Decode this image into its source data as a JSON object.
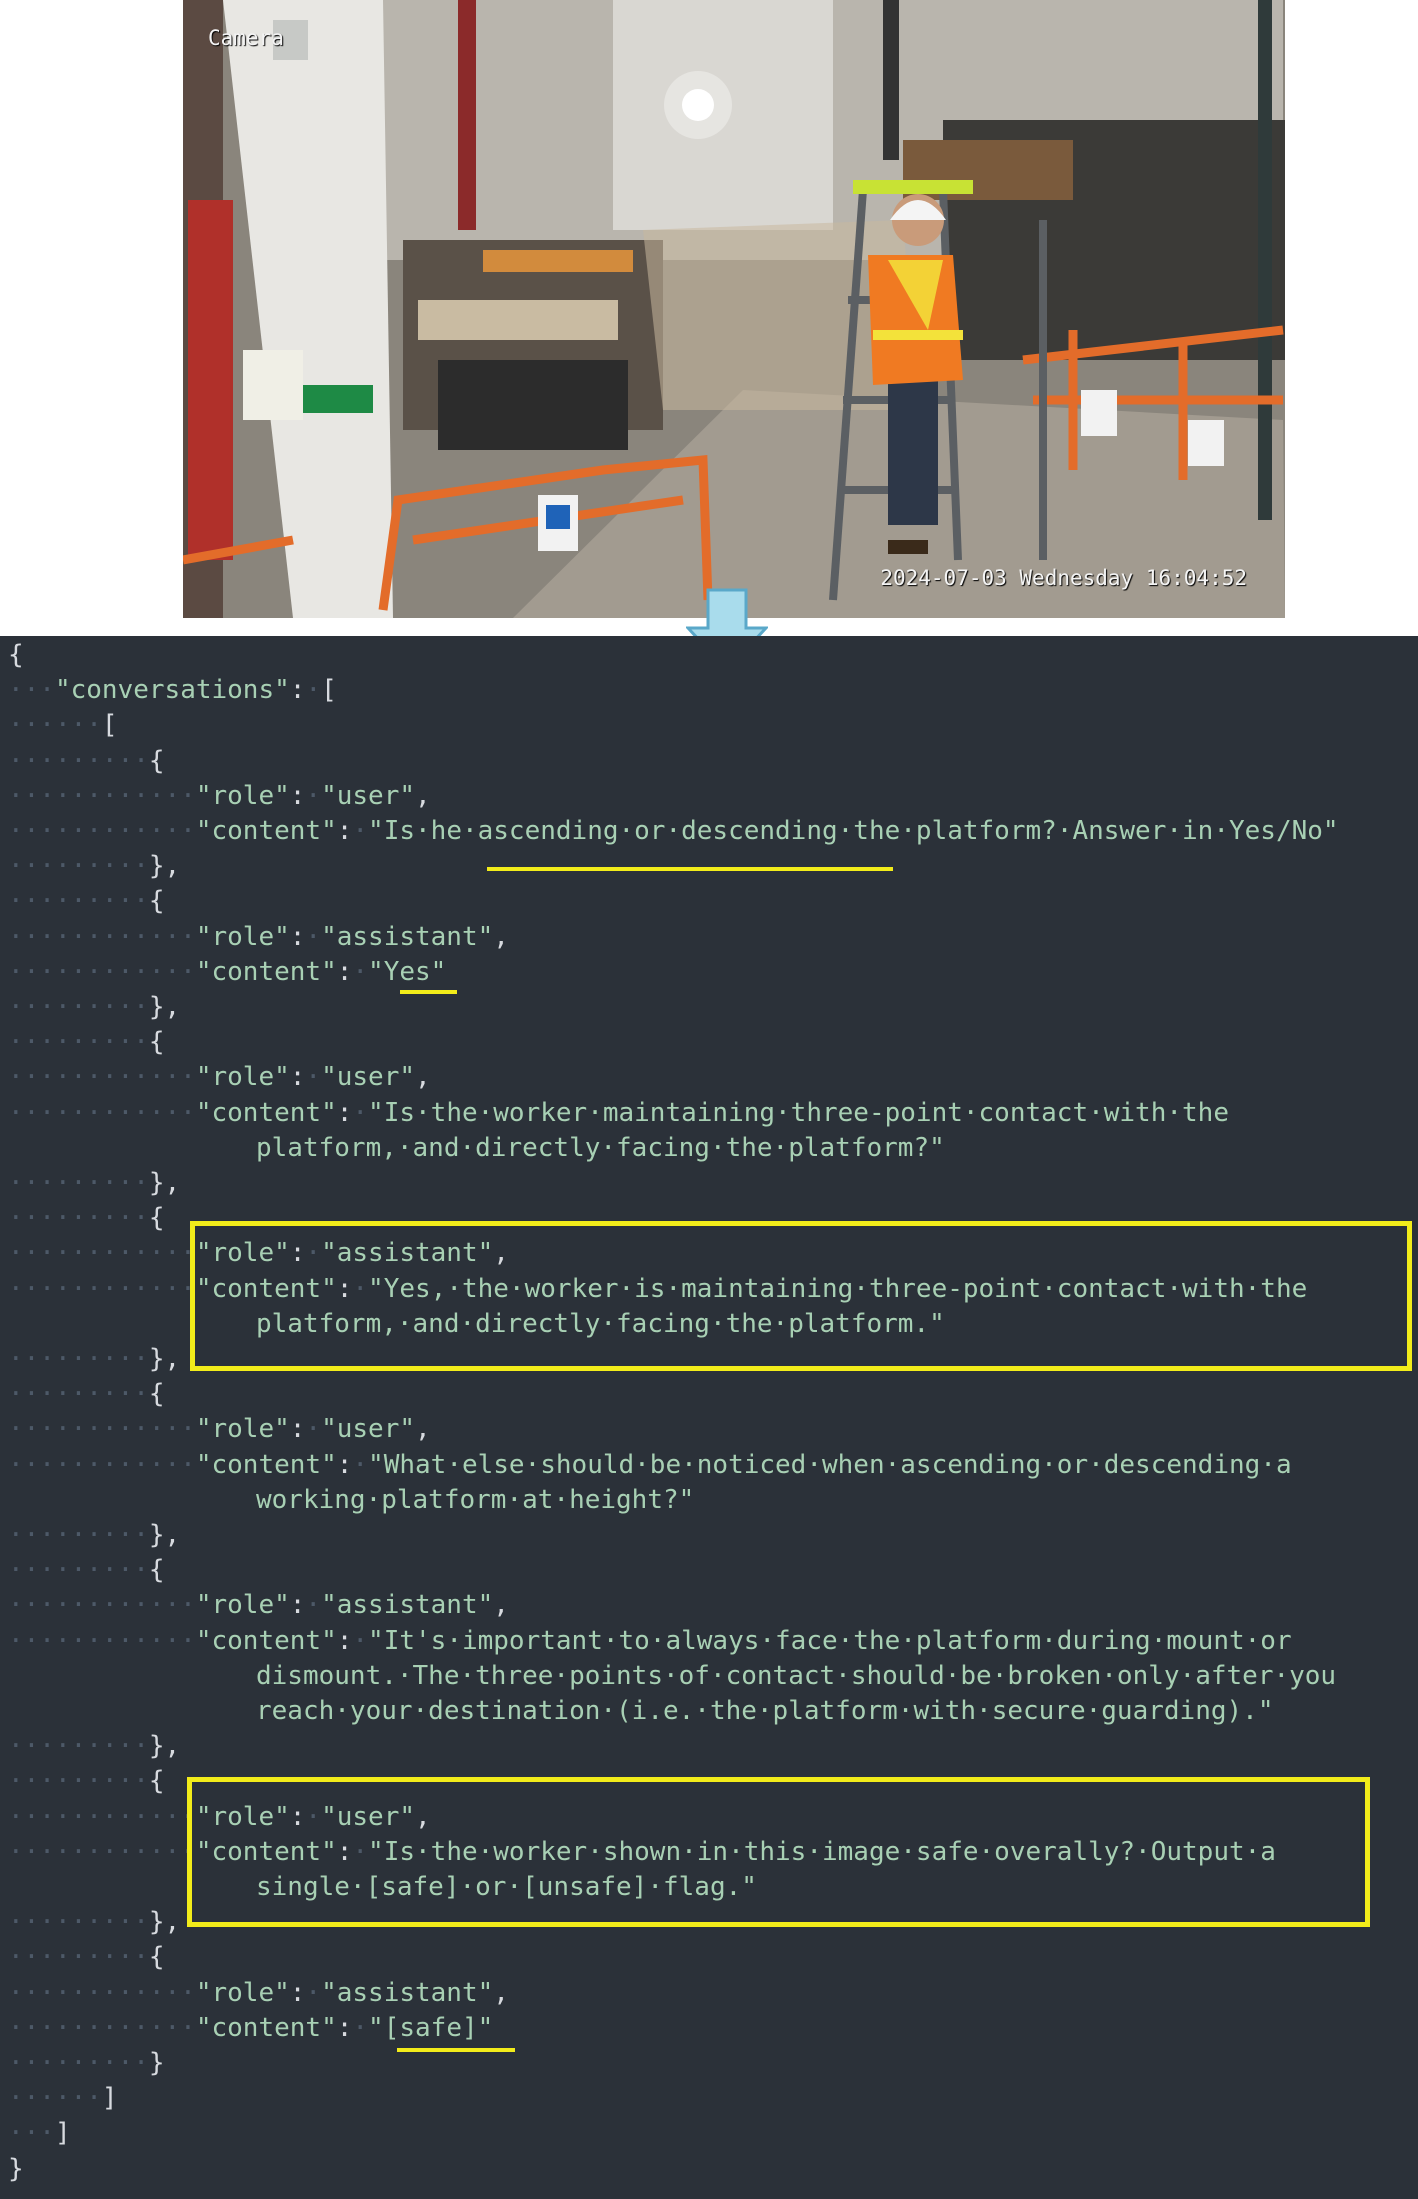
{
  "camera": {
    "label": "Camera",
    "timestamp": "2024-07-03 Wednesday 16:04:52"
  },
  "code": {
    "open_brace": "{",
    "conversations_key": "\"conversations\"",
    "open_array": "[",
    "inner_open_array": "[",
    "close_inner_array": "]",
    "close_array": "]",
    "close_brace": "}",
    "messages": [
      {
        "role_key": "\"role\"",
        "role": "\"user\"",
        "content_key": "\"content\"",
        "content_lines": [
          "\"Is he ascending or descending the platform? Answer in Yes/No\""
        ]
      },
      {
        "role_key": "\"role\"",
        "role": "\"assistant\"",
        "content_key": "\"content\"",
        "content_lines": [
          "\"Yes\""
        ]
      },
      {
        "role_key": "\"role\"",
        "role": "\"user\"",
        "content_key": "\"content\"",
        "content_lines": [
          "\"Is the worker maintaining three-point contact with the",
          "platform, and directly facing the platform?\""
        ]
      },
      {
        "role_key": "\"role\"",
        "role": "\"assistant\"",
        "content_key": "\"content\"",
        "content_lines": [
          "\"Yes, the worker is maintaining three-point contact with the",
          "platform, and directly facing the platform.\""
        ]
      },
      {
        "role_key": "\"role\"",
        "role": "\"user\"",
        "content_key": "\"content\"",
        "content_lines": [
          "\"What else should be noticed when ascending or descending a",
          "working platform at height?\""
        ]
      },
      {
        "role_key": "\"role\"",
        "role": "\"assistant\"",
        "content_key": "\"content\"",
        "content_lines": [
          "\"It's important to always face the platform during mount or",
          "dismount. The three points of contact should be broken only after you",
          "reach your destination (i.e. the platform with secure guarding).\""
        ]
      },
      {
        "role_key": "\"role\"",
        "role": "\"user\"",
        "content_key": "\"content\"",
        "content_lines": [
          "\"Is the worker shown in this image safe overally? Output a",
          "single [safe] or [unsafe] flag.\""
        ]
      },
      {
        "role_key": "\"role\"",
        "role": "\"assistant\"",
        "content_key": "\"content\"",
        "content_lines": [
          "\"[safe]\""
        ]
      }
    ]
  },
  "colors": {
    "panel_bg": "#2b3139",
    "string": "#a8d0b4",
    "highlight": "#f2ec1a",
    "arrow": "#a9dcec"
  }
}
